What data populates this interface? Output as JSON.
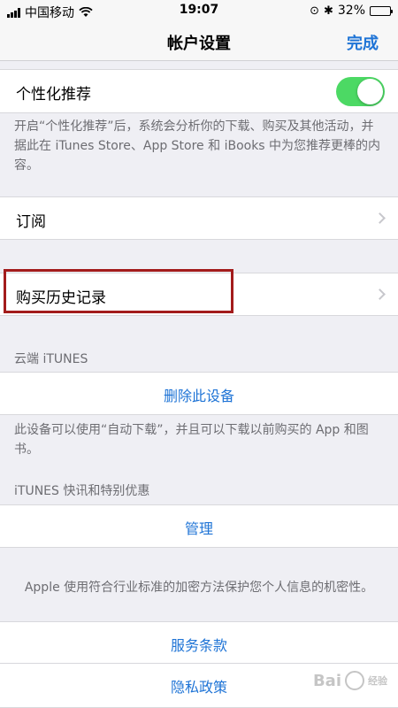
{
  "status_bar": {
    "carrier": "中国移动",
    "time": "19:07",
    "battery_percent": "32%",
    "battery_level": 0.32
  },
  "nav": {
    "title": "帐户设置",
    "done_label": "完成"
  },
  "personalization": {
    "label": "个性化推荐",
    "toggle_on": true,
    "description": "开启“个性化推荐”后，系统会分析你的下载、购买及其他活动，并据此在 iTunes Store、App Store 和 iBooks 中为您推荐更棒的内容。"
  },
  "subscriptions": {
    "label": "订阅"
  },
  "purchase_history": {
    "label": "购买历史记录"
  },
  "itunes_cloud": {
    "header": "云端 iTUNES",
    "remove_device_label": "删除此设备",
    "description": "此设备可以使用“自动下载”，并且可以下载以前购买的 App 和图书。"
  },
  "itunes_news": {
    "header": "iTUNES 快讯和特别优惠",
    "manage_label": "管理"
  },
  "privacy": {
    "description": "Apple 使用符合行业标准的加密方法保护您个人信息的机密性。",
    "terms_label": "服务条款",
    "policy_label": "隐私政策"
  },
  "watermark": {
    "text": "Bai",
    "subtext": "经验"
  },
  "colors": {
    "accent": "#1f74d6",
    "toggle_on": "#4cd964",
    "highlight": "#a31c1c",
    "background": "#efeff4"
  }
}
